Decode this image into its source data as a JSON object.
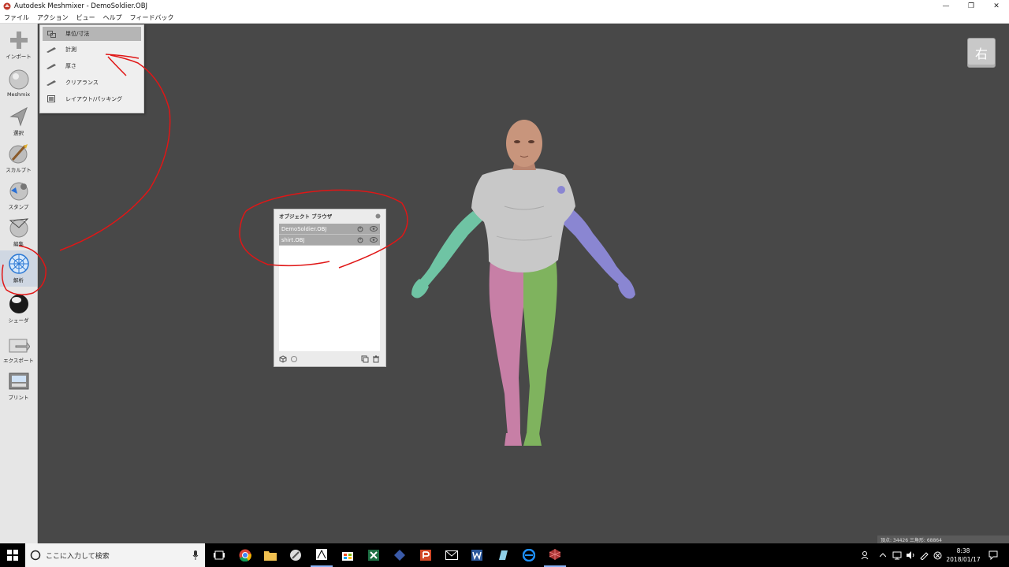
{
  "window": {
    "title": "Autodesk Meshmixer - DemoSoldier.OBJ",
    "minimize": "—",
    "maximize": "❐",
    "close": "✕"
  },
  "menu": [
    "ファイル",
    "アクション",
    "ビュー",
    "ヘルプ",
    "フィードバック"
  ],
  "tools": [
    {
      "label": "インポート",
      "icon": "plus-icon"
    },
    {
      "label": "Meshmix",
      "icon": "sphere-icon"
    },
    {
      "label": "選択",
      "icon": "arrow-select-icon"
    },
    {
      "label": "スカルプト",
      "icon": "brush-icon"
    },
    {
      "label": "スタンプ",
      "icon": "stamp-icon"
    },
    {
      "label": "編集",
      "icon": "edit-icon"
    },
    {
      "label": "解析",
      "icon": "analysis-icon"
    },
    {
      "label": "シェーダ",
      "icon": "shader-icon"
    },
    {
      "label": "エクスポート",
      "icon": "export-icon"
    },
    {
      "label": "プリント",
      "icon": "print-icon"
    }
  ],
  "analysis_menu": [
    {
      "label": "単位/寸法",
      "icon": "units-icon"
    },
    {
      "label": "計測",
      "icon": "ruler-icon"
    },
    {
      "label": "厚さ",
      "icon": "ruler-icon"
    },
    {
      "label": "クリアランス",
      "icon": "ruler-icon"
    },
    {
      "label": "レイアウト/パッキング",
      "icon": "layout-icon"
    }
  ],
  "viewcube": {
    "face": "右"
  },
  "object_browser": {
    "title": "オブジェクト ブラウザ",
    "objects": [
      {
        "name": "DemoSoldier.OBJ"
      },
      {
        "name": "shirt.OBJ"
      }
    ]
  },
  "status": {
    "text": "頂点: 34426 三角形: 68864"
  },
  "taskbar": {
    "search_placeholder": "ここに入力して検索",
    "time": "8:38",
    "date": "2018/01/17"
  },
  "colors": {
    "viewport": "#484848",
    "toolbar": "#e6e6e6",
    "shirt": "#c8c8c8",
    "left_arm": "#6fc4a4",
    "right_arm": "#8a86d2",
    "left_leg": "#c77fa6",
    "right_leg": "#7fb35e",
    "skin": "#c8957c",
    "annotation": "#e01616"
  }
}
